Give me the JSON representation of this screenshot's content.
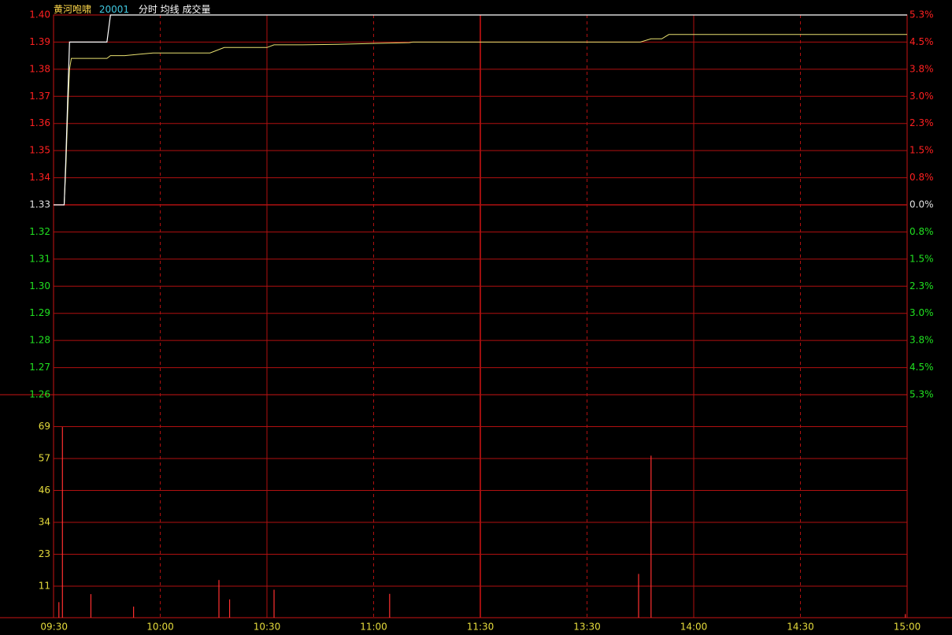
{
  "header": {
    "stock_name": "黄河咆啸",
    "stock_code": "20001",
    "legend_text": "分时 均线 成交量"
  },
  "colors": {
    "background": "#000000",
    "grid": "#b01010",
    "frame": "#c81414",
    "price_line": "#ffffff",
    "avg_line": "#e8e070",
    "volume_bar": "#ff3030",
    "up_label": "#ff2020",
    "down_label": "#20e020",
    "neutral_label": "#e0e0e0",
    "volume_label": "#e6dc3c",
    "time_label": "#e6dc3c",
    "name_color": "#ffd84a",
    "code_color": "#40c8e0",
    "legend_color": "#ffffff"
  },
  "chart_data": {
    "type": "line",
    "x_ticks": [
      "09:30",
      "10:00",
      "10:30",
      "11:00",
      "11:30",
      "13:30",
      "14:00",
      "14:30",
      "15:00"
    ],
    "total_minutes": 240,
    "price_axis": {
      "base": 1.33,
      "ylim": [
        1.26,
        1.4
      ],
      "labels_up": [
        "1.40",
        "1.39",
        "1.38",
        "1.37",
        "1.36",
        "1.35",
        "1.34"
      ],
      "label_base": "1.33",
      "labels_down": [
        "1.32",
        "1.31",
        "1.30",
        "1.29",
        "1.28",
        "1.27",
        "1.26"
      ],
      "pct_up": [
        "5.3%",
        "4.5%",
        "3.8%",
        "3.0%",
        "2.3%",
        "1.5%",
        "0.8%"
      ],
      "pct_base": "0.0%",
      "pct_down": [
        "0.8%",
        "1.5%",
        "2.3%",
        "3.0%",
        "3.8%",
        "4.5%",
        "5.3%"
      ]
    },
    "volume_axis": {
      "labels": [
        "69",
        "57",
        "46",
        "34",
        "23",
        "11"
      ],
      "ylim": [
        0,
        80.5
      ]
    },
    "series": [
      {
        "key": "price",
        "points": [
          [
            0,
            1.33
          ],
          [
            1,
            1.33
          ],
          [
            2,
            1.33
          ],
          [
            3,
            1.33
          ],
          [
            3.4,
            1.345
          ],
          [
            4,
            1.37
          ],
          [
            4.5,
            1.39
          ],
          [
            5,
            1.39
          ],
          [
            6,
            1.39
          ],
          [
            8,
            1.39
          ],
          [
            15,
            1.39
          ],
          [
            16,
            1.4
          ],
          [
            240,
            1.4
          ]
        ]
      },
      {
        "key": "avg",
        "points": [
          [
            0,
            1.33
          ],
          [
            1,
            1.33
          ],
          [
            2,
            1.33
          ],
          [
            3,
            1.33
          ],
          [
            3.5,
            1.345
          ],
          [
            4,
            1.365
          ],
          [
            4.5,
            1.38
          ],
          [
            5,
            1.384
          ],
          [
            15,
            1.384
          ],
          [
            16,
            1.385
          ],
          [
            20,
            1.385
          ],
          [
            24,
            1.3855
          ],
          [
            28,
            1.386
          ],
          [
            36,
            1.386
          ],
          [
            44,
            1.386
          ],
          [
            47,
            1.3875
          ],
          [
            48,
            1.388
          ],
          [
            55,
            1.388
          ],
          [
            60,
            1.388
          ],
          [
            62,
            1.389
          ],
          [
            70,
            1.389
          ],
          [
            80,
            1.3892
          ],
          [
            90,
            1.3895
          ],
          [
            100,
            1.3898
          ],
          [
            101,
            1.39
          ],
          [
            120,
            1.39
          ],
          [
            150,
            1.39
          ],
          [
            165,
            1.39
          ],
          [
            168,
            1.3912
          ],
          [
            171,
            1.3912
          ],
          [
            173,
            1.3928
          ],
          [
            200,
            1.3928
          ],
          [
            240,
            1.3928
          ]
        ]
      }
    ],
    "volumes": [
      [
        1.5,
        5.6
      ],
      [
        2.5,
        68.8
      ],
      [
        10.5,
        8.5
      ],
      [
        22.5,
        4.0
      ],
      [
        46.5,
        13.6
      ],
      [
        49.5,
        6.6
      ],
      [
        62,
        10.1
      ],
      [
        94.5,
        8.6
      ],
      [
        164.5,
        15.8
      ],
      [
        168,
        58.5
      ],
      [
        239.5,
        1.3
      ]
    ]
  }
}
